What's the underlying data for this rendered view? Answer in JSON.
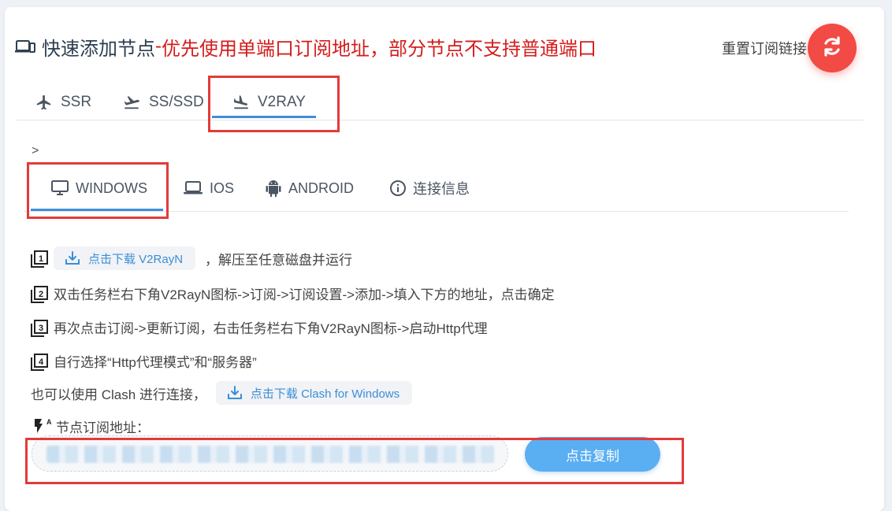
{
  "header": {
    "title_main": "快速添加节点",
    "title_sep": "-",
    "title_red": "优先使用单端口订阅地址，部分节点不支持普通端口",
    "reset_label": "重置订阅链接",
    "reset_icon": "refresh-icon",
    "colors": {
      "accent_red": "#f24a45",
      "warning_text": "#d51c1c"
    }
  },
  "protocol_tabs": [
    {
      "label": "SSR",
      "icon": "airplane-icon"
    },
    {
      "label": "SS/SSD",
      "icon": "flight-takeoff-icon"
    },
    {
      "label": "V2RAY",
      "icon": "flight-land-icon",
      "active": true
    }
  ],
  "breadcrumb_marker": ">",
  "os_tabs": [
    {
      "label": "WINDOWS",
      "icon": "desktop-icon",
      "active": true
    },
    {
      "label": "IOS",
      "icon": "laptop-icon"
    },
    {
      "label": "ANDROID",
      "icon": "android-icon"
    },
    {
      "label": "连接信息",
      "icon": "info-icon"
    }
  ],
  "steps": [
    {
      "num": "1",
      "download_label": "点击下载 V2RayN",
      "text": "，解压至任意磁盘并运行"
    },
    {
      "num": "2",
      "text": "双击任务栏右下角V2RayN图标->订阅->订阅设置->添加->填入下方的地址，点击确定"
    },
    {
      "num": "3",
      "text": "再次点击订阅->更新订阅，右击任务栏右下角V2RayN图标->启动Http代理"
    },
    {
      "num": "4",
      "text": "自行选择“Http代理模式”和“服务器”"
    }
  ],
  "clash": {
    "text": "也可以使用 Clash 进行连接，",
    "download_label": "点击下载 Clash for Windows"
  },
  "subscription": {
    "label": "节点订阅地址：",
    "copy_label": "点击复制"
  },
  "accent": "#3f8ed8"
}
